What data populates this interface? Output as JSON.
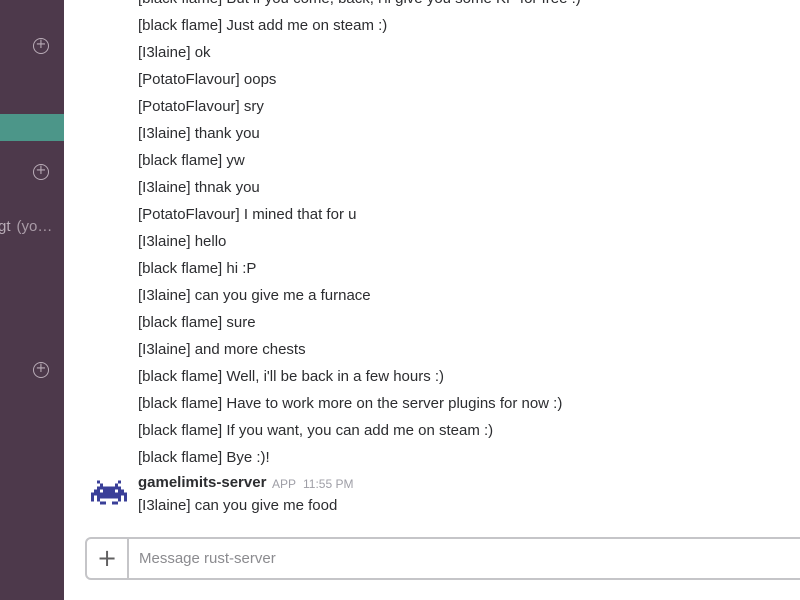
{
  "sidebar": {
    "dm_name": "gt",
    "dm_you": "(yo…"
  },
  "messages": [
    "[black flame] But if you come, back, i'll give you some KP for free :)",
    "[black flame] Just add me on steam :)",
    "[I3laine] ok",
    "[PotatoFlavour] oops",
    "[PotatoFlavour] sry",
    "[I3laine] thank you",
    "[black flame] yw",
    "[I3laine] thnak you",
    "[PotatoFlavour] I mined that for u",
    "[I3laine] hello",
    "[black flame] hi :P",
    "[I3laine] can you give me a furnace",
    "[black flame] sure",
    "[I3laine] and more chests",
    "[black flame] Well, i'll be back in a few hours :)",
    "[black flame] Have to work more on the server plugins for now :)",
    "[black flame] If you want, you can add me on steam :)",
    "[black flame] Bye :)!"
  ],
  "last_group": {
    "sender": "gamelimits-server",
    "badge": "APP",
    "time": "11:55 PM",
    "text": "[I3laine] can you give me food",
    "avatar_icon": "space-invader-icon"
  },
  "composer": {
    "plus_label": "+",
    "placeholder": "Message rust-server"
  },
  "colors": {
    "sidebar": "#4d394b",
    "active_channel": "#4c9689",
    "avatar": "#3a3f98"
  }
}
